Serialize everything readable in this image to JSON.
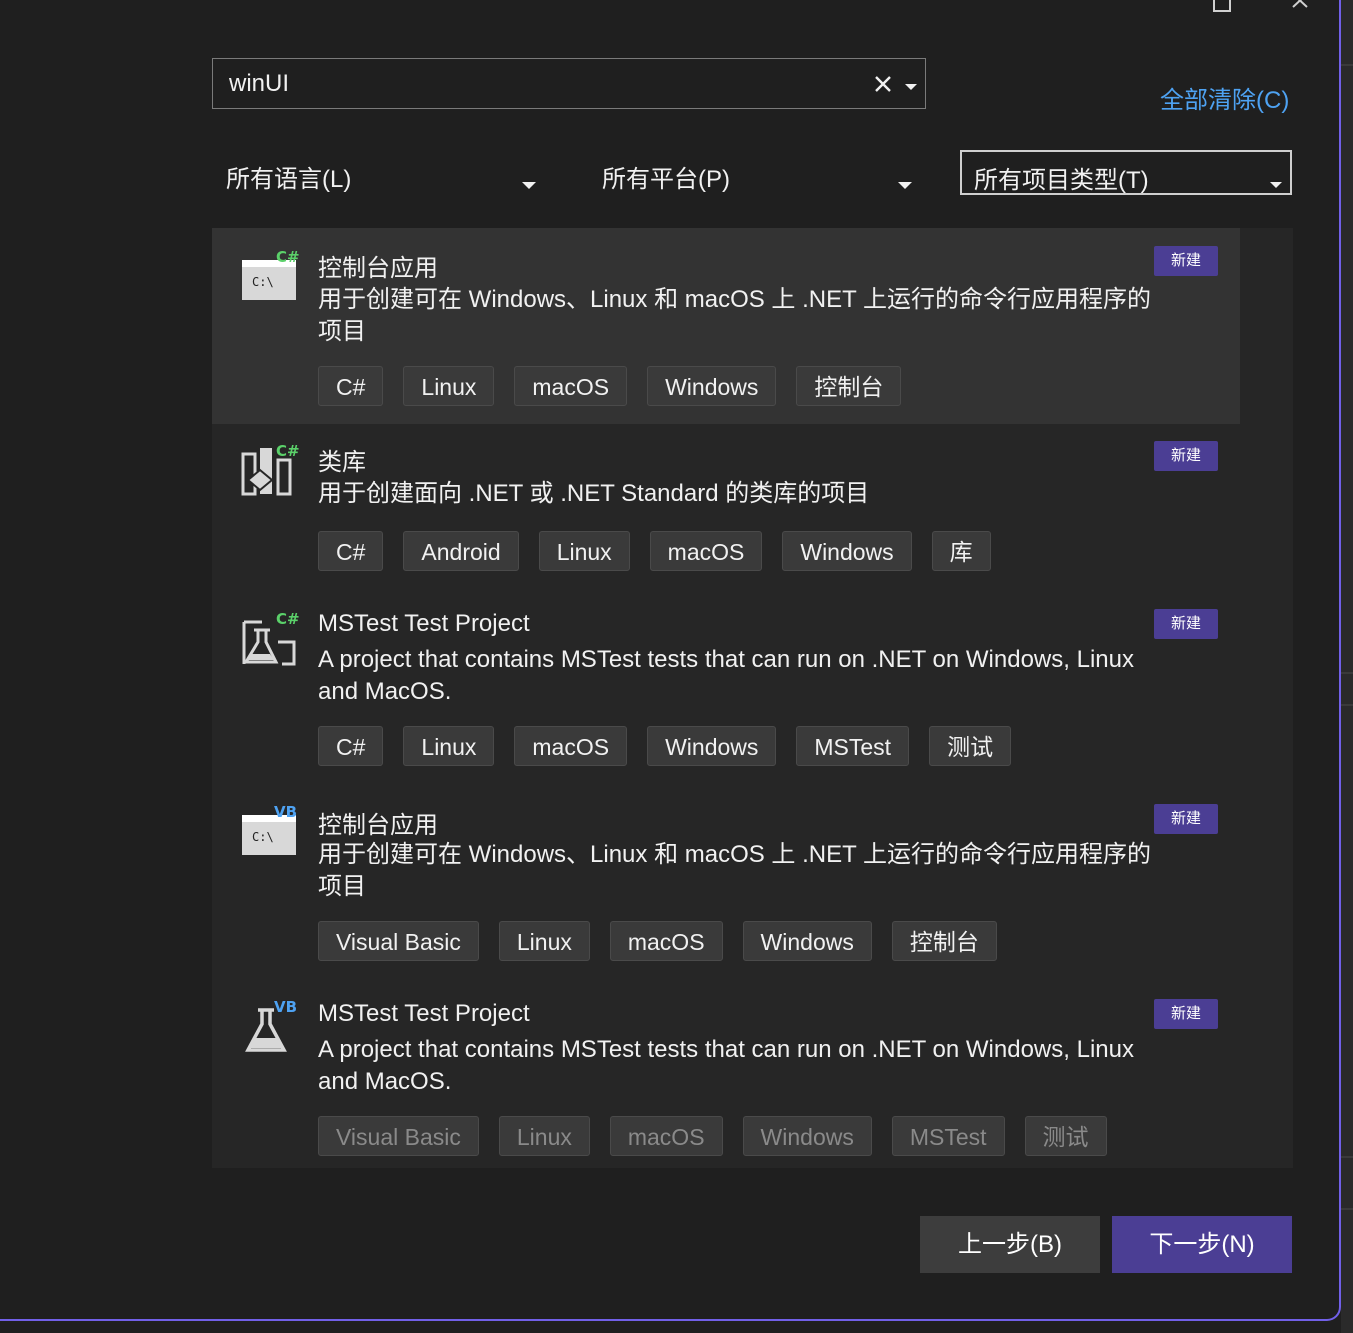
{
  "search": {
    "value": "winUI"
  },
  "clear_all_label": "全部清除(C)",
  "filters": {
    "language": "所有语言(L)",
    "platform": "所有平台(P)",
    "project_type": "所有项目类型(T)"
  },
  "templates": [
    {
      "icon": "console-app-csharp-icon",
      "lang_badge": "C#",
      "lang_color": "#5bd16a",
      "title": "控制台应用",
      "description": "用于创建可在 Windows、Linux 和 macOS 上 .NET 上运行的命令行应用程序的项目",
      "badge": "新建",
      "tags": [
        "C#",
        "Linux",
        "macOS",
        "Windows",
        "控制台"
      ]
    },
    {
      "icon": "class-library-csharp-icon",
      "lang_badge": "C#",
      "lang_color": "#5bd16a",
      "title": "类库",
      "description": "用于创建面向 .NET 或 .NET Standard 的类库的项目",
      "badge": "新建",
      "tags": [
        "C#",
        "Android",
        "Linux",
        "macOS",
        "Windows",
        "库"
      ]
    },
    {
      "icon": "mstest-csharp-icon",
      "lang_badge": "C#",
      "lang_color": "#5bd16a",
      "title": "MSTest Test Project",
      "description": "A project that contains MSTest tests that can run on .NET on Windows, Linux and MacOS.",
      "badge": "新建",
      "tags": [
        "C#",
        "Linux",
        "macOS",
        "Windows",
        "MSTest",
        "测试"
      ]
    },
    {
      "icon": "console-app-vb-icon",
      "lang_badge": "VB",
      "lang_color": "#4ea2f2",
      "title": "控制台应用",
      "description": "用于创建可在 Windows、Linux 和 macOS 上 .NET 上运行的命令行应用程序的项目",
      "badge": "新建",
      "tags": [
        "Visual Basic",
        "Linux",
        "macOS",
        "Windows",
        "控制台"
      ]
    },
    {
      "icon": "mstest-vb-icon",
      "lang_badge": "VB",
      "lang_color": "#4ea2f2",
      "title": "MSTest Test Project",
      "description": "A project that contains MSTest tests that can run on .NET on Windows, Linux and MacOS.",
      "badge": "新建",
      "tags": [
        "Visual Basic",
        "Linux",
        "macOS",
        "Windows",
        "MSTest",
        "测试"
      ]
    }
  ],
  "buttons": {
    "back": "上一步(B)",
    "next": "下一步(N)"
  },
  "colors": {
    "accent": "#4b3e94",
    "border_accent": "#7160e8",
    "link": "#4ea2f2"
  }
}
